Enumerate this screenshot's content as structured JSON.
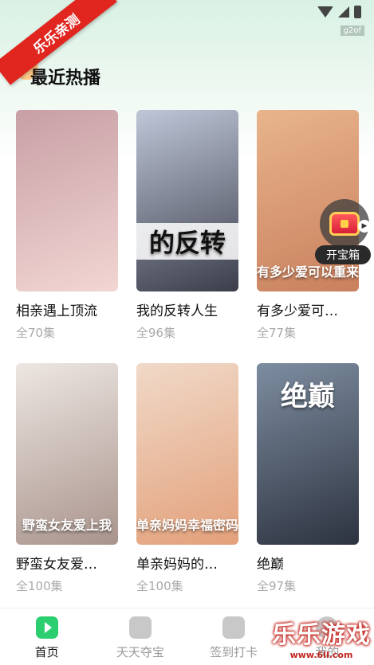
{
  "ribbon": "乐乐亲测",
  "watermark_small": "g2of",
  "section_title": "最近热播",
  "dramas": [
    {
      "title": "相亲遇上顶流",
      "episodes": "全70集",
      "poster_text": "",
      "colors": [
        "#c79fa5",
        "#f2d6d3"
      ]
    },
    {
      "title": "我的反转人生",
      "episodes": "全96集",
      "poster_text": "的反转",
      "colors": [
        "#bfc7d8",
        "#3b3d4a"
      ]
    },
    {
      "title": "有多少爱可…",
      "episodes": "全77集",
      "poster_text": "有多少爱可以重来",
      "colors": [
        "#e8b48c",
        "#c9805d"
      ]
    },
    {
      "title": "野蛮女友爱…",
      "episodes": "全100集",
      "poster_text": "野蛮女友爱上我",
      "colors": [
        "#ede6e2",
        "#a9948c"
      ]
    },
    {
      "title": "单亲妈妈的…",
      "episodes": "全100集",
      "poster_text": "单亲妈妈幸福密码",
      "colors": [
        "#f0d9c8",
        "#e3a07a"
      ]
    },
    {
      "title": "绝巅",
      "episodes": "全97集",
      "poster_text": "绝巅",
      "colors": [
        "#7d8da0",
        "#2d3340"
      ]
    }
  ],
  "treasure_label": "开宝箱",
  "tabs": [
    {
      "label": "首页",
      "icon": "play-icon"
    },
    {
      "label": "天天夺宝",
      "icon": "gift-icon"
    },
    {
      "label": "签到打卡",
      "icon": "calendar-check-icon"
    },
    {
      "label": "我的",
      "icon": "user-icon"
    }
  ],
  "brand": {
    "main": "乐乐游戏",
    "sub": "www.6ll.com"
  }
}
